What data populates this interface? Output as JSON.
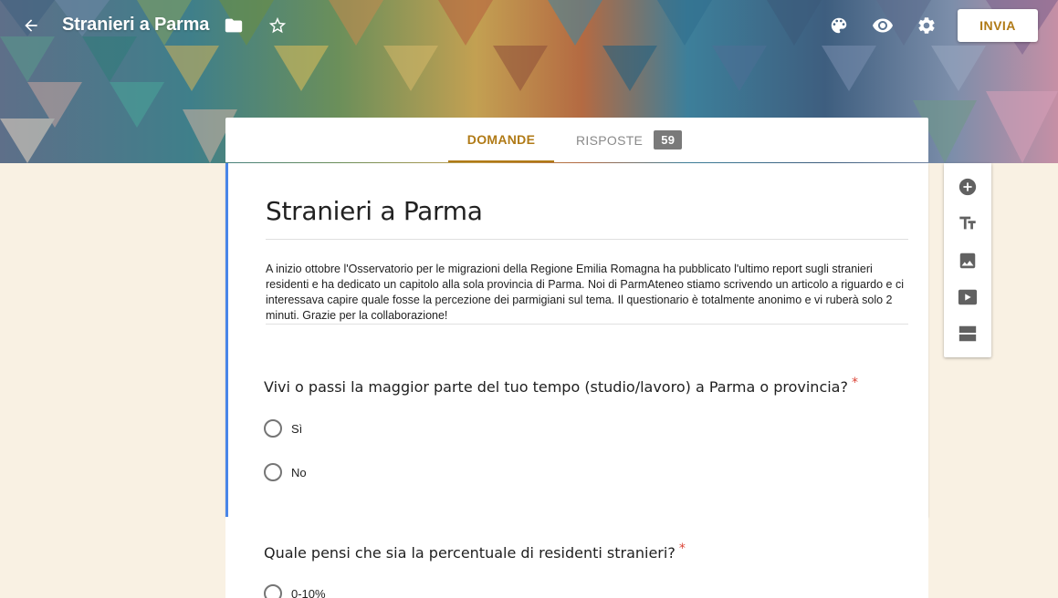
{
  "header": {
    "title": "Stranieri a Parma",
    "send_label": "INVIA",
    "icons": [
      "back-arrow-icon",
      "folder-icon",
      "star-icon",
      "palette-icon",
      "eye-icon",
      "gear-icon"
    ]
  },
  "tabs": {
    "questions": "DOMANDE",
    "responses": "RISPOSTE",
    "responses_count": "59"
  },
  "form": {
    "title": "Stranieri a Parma",
    "description": "A inizio ottobre l'Osservatorio per le migrazioni della Regione Emilia Romagna ha pubblicato l'ultimo report sugli stranieri residenti e ha dedicato un capitolo alla sola provincia di Parma. Noi di ParmAteneo stiamo scrivendo un articolo a riguardo e ci interessava capire quale fosse la percezione dei parmigiani sul tema. Il questionario è totalmente anonimo e vi ruberà solo 2 minuti. Grazie per la collaborazione!",
    "questions": [
      {
        "title": "Vivi o passi la maggior parte del tuo tempo (studio/lavoro) a Parma o provincia?",
        "required": "*",
        "options": [
          "Sì",
          "No"
        ]
      },
      {
        "title": "Quale pensi che sia la percentuale di residenti stranieri?",
        "required": "*",
        "options": [
          "0-10%"
        ]
      }
    ]
  },
  "toolbar": {
    "icons": [
      "add-question-icon",
      "add-title-icon",
      "add-image-icon",
      "add-video-icon",
      "add-section-icon"
    ]
  },
  "colors": {
    "accent": "#b07a16",
    "form_border": "#4a86e8",
    "required": "#db4437",
    "background": "#f9f1e3"
  }
}
